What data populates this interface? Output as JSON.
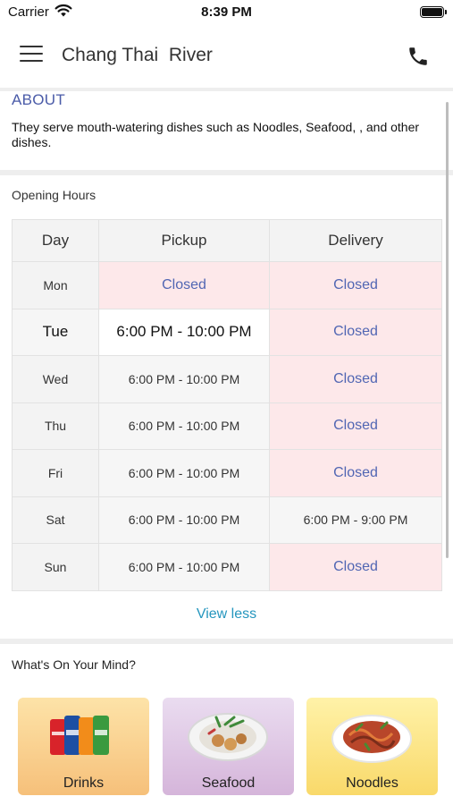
{
  "status_bar": {
    "carrier": "Carrier",
    "time": "8:39 PM"
  },
  "navbar": {
    "title": "Chang Thai  River"
  },
  "about": {
    "title": "ABOUT",
    "text": "They serve mouth-watering dishes such as Noodles, Seafood, ,  and other dishes."
  },
  "hours": {
    "title": "Opening Hours",
    "headers": [
      "Day",
      "Pickup",
      "Delivery"
    ],
    "rows": [
      {
        "day": "Mon",
        "pickup": "Closed",
        "delivery": "Closed"
      },
      {
        "day": "Tue",
        "pickup": "6:00 PM - 10:00 PM",
        "delivery": "Closed"
      },
      {
        "day": "Wed",
        "pickup": "6:00 PM - 10:00 PM",
        "delivery": "Closed"
      },
      {
        "day": "Thu",
        "pickup": "6:00 PM - 10:00 PM",
        "delivery": "Closed"
      },
      {
        "day": "Fri",
        "pickup": "6:00 PM - 10:00 PM",
        "delivery": "Closed"
      },
      {
        "day": "Sat",
        "pickup": "6:00 PM - 10:00 PM",
        "delivery": "6:00 PM - 9:00 PM"
      },
      {
        "day": "Sun",
        "pickup": "6:00 PM - 10:00 PM",
        "delivery": "Closed"
      }
    ],
    "view_less": "View less"
  },
  "mind": {
    "title": "What's On Your Mind?",
    "categories": [
      {
        "label": "Drinks"
      },
      {
        "label": "Seafood"
      },
      {
        "label": "Noodles"
      }
    ]
  },
  "icons": {
    "menu": "hamburger-menu-icon",
    "phone": "phone-icon",
    "wifi": "wifi-icon",
    "battery": "battery-icon"
  },
  "colors": {
    "accent_blue": "#4a5ba8",
    "link_teal": "#2596be",
    "closed_bg": "#fde8ea"
  }
}
